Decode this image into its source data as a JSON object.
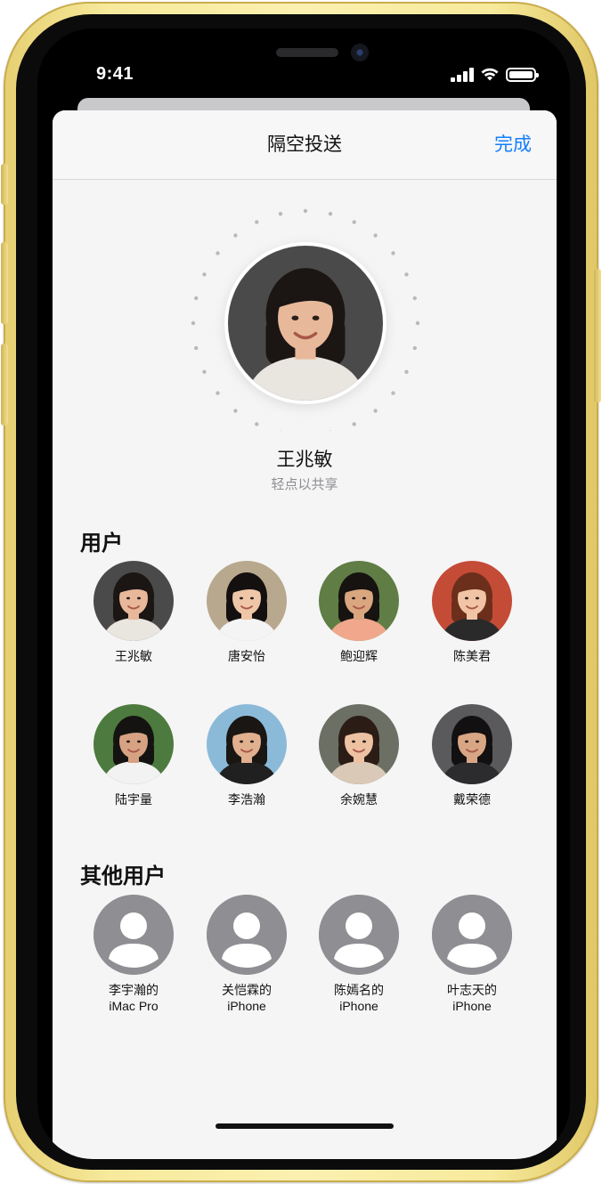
{
  "status_bar": {
    "time": "9:41"
  },
  "sheet": {
    "title": "隔空投送",
    "done_label": "完成"
  },
  "featured": {
    "name": "王兆敏",
    "hint": "轻点以共享"
  },
  "people_section": {
    "heading": "用户",
    "people": [
      {
        "name": "王兆敏",
        "bg": "#4a4a4a",
        "skin": "#e7b89a",
        "hair": "#1b1514",
        "shirt": "#e9e5df"
      },
      {
        "name": "唐安怡",
        "bg": "#b8a88e",
        "skin": "#efc7a8",
        "hair": "#141010",
        "shirt": "#f4f4f4"
      },
      {
        "name": "鲍迎辉",
        "bg": "#5f7d45",
        "skin": "#d9a67f",
        "hair": "#161311",
        "shirt": "#f0a78b"
      },
      {
        "name": "陈美君",
        "bg": "#c44b36",
        "skin": "#f0c4a4",
        "hair": "#6b2f1c",
        "shirt": "#2a2a2a"
      },
      {
        "name": "陆宇量",
        "bg": "#4d7a3e",
        "skin": "#d7a283",
        "hair": "#151312",
        "shirt": "#f2f2f2"
      },
      {
        "name": "李浩瀚",
        "bg": "#8bbad9",
        "skin": "#e0b08f",
        "hair": "#1a1614",
        "shirt": "#202020"
      },
      {
        "name": "余婉慧",
        "bg": "#6b6f64",
        "skin": "#edc2a2",
        "hair": "#2b1d15",
        "shirt": "#d9c9b6"
      },
      {
        "name": "戴荣德",
        "bg": "#5a5a5c",
        "skin": "#d8a685",
        "hair": "#121010",
        "shirt": "#2c2c2e"
      }
    ]
  },
  "devices_section": {
    "heading": "其他用户",
    "devices": [
      {
        "line1": "李宇瀚的",
        "line2": "iMac Pro"
      },
      {
        "line1": "关恺霖的",
        "line2": "iPhone"
      },
      {
        "line1": "陈嫣名的",
        "line2": "iPhone"
      },
      {
        "line1": "叶志天的",
        "line2": "iPhone"
      }
    ]
  },
  "colors": {
    "accent": "#147efb",
    "phone_frame": "#f5e79a",
    "avatar_gray": "#8e8e93"
  }
}
